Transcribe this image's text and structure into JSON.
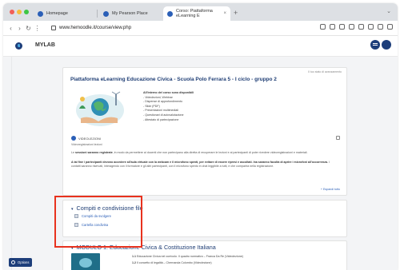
{
  "browser": {
    "tabs": [
      {
        "label": "Homepage"
      },
      {
        "label": "My Pearson Place"
      },
      {
        "label": "Corso: Piattaforma eLearning E"
      }
    ],
    "new_tab": "+",
    "url": "www.hemoodle.it/course/view.php"
  },
  "app": {
    "brand": "MYLAB"
  },
  "course": {
    "title": "Piattaforma eLearning Educazione Civica - Scuola Polo Ferrara 5 - I ciclo - gruppo 2",
    "status_link": "Il tuo stato di avanzamento",
    "list_heading": "All'interno del corso sono disponibili",
    "list_items": [
      "- Videolezioni, Webinar",
      "- Dispense di approfondimento",
      "- Slide (PDF)",
      "- Presentazioni multimediali",
      "- Questionari di autovalutazione",
      "- Attestato di partecipazione"
    ],
    "video_label": "VIDEOLEZIONI",
    "video_sub": "Videoregistrazioni lezioni",
    "para1_pre": "Le ",
    "para1_bold": "sessioni saranno registrate",
    "para1_post": ", in modo da permettere ai docenti che non partecipano alla diretta di recuperare le lezioni e ai partecipanti di poter rivedere videoregistrazioni e materiali.",
    "para2_pre": "",
    "para2_bold": "A tal fine i partecipanti devono accedere all'aula virtuale con la webcam e il microfono spenti, per evitare di essere ripresi e ascoltati. Ina saranno facoltà di aprire i microfoni all'occorrenza.",
    "para2_post": " I contatti saranno riservati, interagendo con il formatore e gli altri partecipanti, con il microfono spento in chat leggibile a tutti, e che comparirà nella registrazione.",
    "expand_all": "+ Espandi tutto"
  },
  "share_section": {
    "title": "Compiti e condivisione file",
    "items": [
      {
        "label": "Compiti da svolgere"
      },
      {
        "label": "Cartella condivisa"
      }
    ]
  },
  "module_section": {
    "title": "MODULO 1. Educazione Civica & Costituzione Italiana",
    "lines": [
      {
        "num": "1.1",
        "text": " Educazione Civica nel curricolo. Il quadro normativo – Franca Da Re (Videolezione)"
      },
      {
        "num": "1.2",
        "text": " Il concetto di legalità – Chernanda Colombo (Videolezione)"
      }
    ]
  },
  "footer": {
    "options_label": "Options"
  },
  "colors": {
    "accent": "#1e3d74",
    "link": "#2b5fb7",
    "highlight": "#e8321e"
  }
}
